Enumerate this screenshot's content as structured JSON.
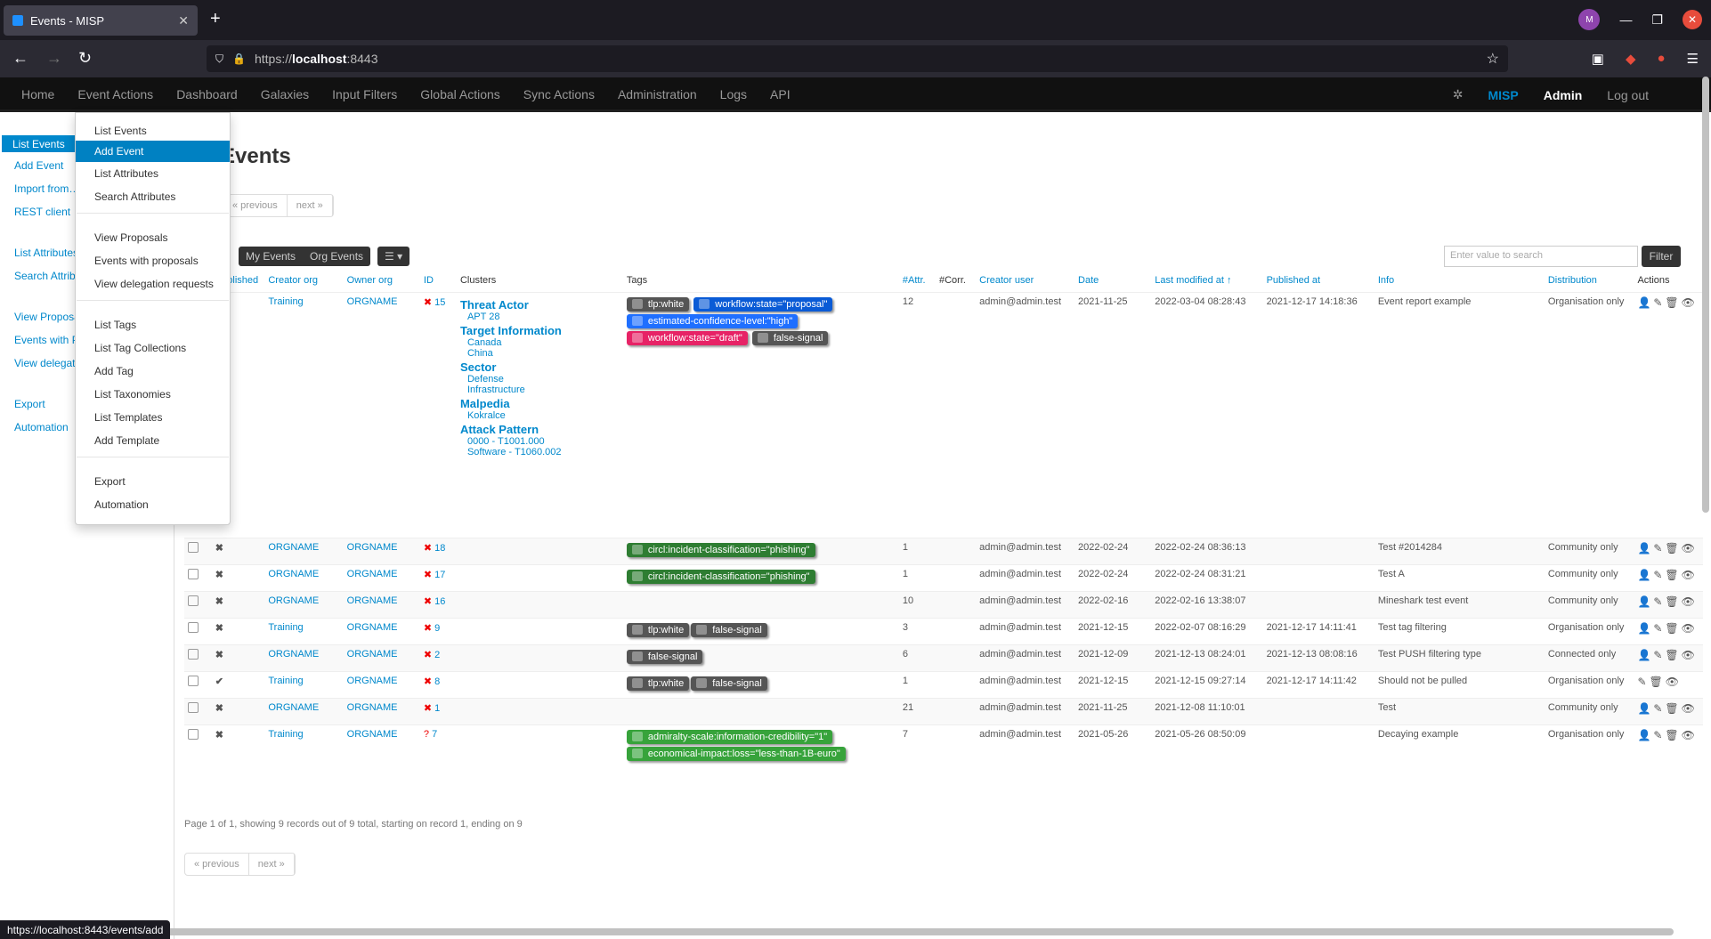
{
  "browser": {
    "tab_title": "Events - MISP",
    "url_prefix": "https://",
    "url_host": "localhost",
    "url_port": ":8443",
    "status_url": "https://localhost:8443/events/add"
  },
  "misp_menu": [
    "Home",
    "Event Actions",
    "Dashboard",
    "Galaxies",
    "Input Filters",
    "Global Actions",
    "Sync Actions",
    "Administration",
    "Logs",
    "API"
  ],
  "misp_right": {
    "org": "MISP",
    "user": "Admin",
    "logout": "Log out"
  },
  "sidebar": {
    "active": "List Events",
    "items": [
      "Add Event",
      "Import from…",
      "REST client",
      "List Attributes",
      "Search Attributes",
      "View Proposals",
      "Events with Proposals",
      "View delegation requests",
      "Export",
      "Automation"
    ]
  },
  "dropdown": {
    "items": [
      "List Events",
      "Add Event",
      "List Attributes",
      "Search Attributes",
      "View Proposals",
      "Events with proposals",
      "View delegation requests",
      "List Tags",
      "List Tag Collections",
      "Add Tag",
      "List Taxonomies",
      "List Templates",
      "Add Template",
      "Export",
      "Automation"
    ],
    "active": "Add Event"
  },
  "page_title": "Events",
  "pager": {
    "prev": "« previous",
    "next": "next »",
    "info": "Page 1 of 1, showing 9 records out of 9 total, starting on record 1, ending on 9"
  },
  "filters": {
    "my_events": "My Events",
    "org_events": "Org Events",
    "search_placeholder": "Enter value to search",
    "filter_btn": "Filter"
  },
  "table": {
    "headers": [
      "Published",
      "Creator org",
      "Owner org",
      "ID",
      "Clusters",
      "Tags",
      "#Attr.",
      "#Corr.",
      "Creator user",
      "Date",
      "Last modified at ↑",
      "Published at",
      "Info",
      "Distribution",
      "Actions"
    ],
    "first_row": {
      "creator": "Training",
      "owner": "ORGNAME",
      "id": "15",
      "clusters": [
        {
          "name": "Threat Actor",
          "values": [
            "APT 28"
          ]
        },
        {
          "name": "Target Information",
          "values": [
            "Canada",
            "China"
          ]
        },
        {
          "name": "Sector",
          "values": [
            "Defense",
            "Infrastructure"
          ]
        },
        {
          "name": "Malpedia",
          "values": [
            "Kokralce"
          ]
        },
        {
          "name": "Attack Pattern",
          "values": [
            "0000 - T1001.000",
            "Software - T1060.002"
          ]
        }
      ],
      "tags": [
        "tlp:white",
        "workflow:state=\"proposal\"",
        "estimated-confidence-level:\"high\"",
        "workflow:state=\"draft\"",
        "false-signal"
      ],
      "attr": "12",
      "user": "admin@admin.test",
      "date": "2021-11-25",
      "modified": "2022-03-04 08:28:43",
      "published_at": "2021-12-17 14:18:36",
      "info": "Event report example",
      "distribution": "Organisation only"
    },
    "rows": [
      {
        "id": "18",
        "creator": "ORGNAME",
        "owner": "ORGNAME",
        "tags": [
          "circl:incident-classification=\"phishing\""
        ],
        "attr": "1",
        "user": "admin@admin.test",
        "date": "2022-02-24",
        "modified": "2022-02-24 08:36:13",
        "published_at": "",
        "info": "Test #2014284",
        "distribution": "Community only",
        "pub": "✖"
      },
      {
        "id": "17",
        "creator": "ORGNAME",
        "owner": "ORGNAME",
        "tags": [
          "circl:incident-classification=\"phishing\""
        ],
        "attr": "1",
        "user": "admin@admin.test",
        "date": "2022-02-24",
        "modified": "2022-02-24 08:31:21",
        "published_at": "",
        "info": "Test A",
        "distribution": "Community only",
        "pub": "✖"
      },
      {
        "id": "16",
        "creator": "ORGNAME",
        "owner": "ORGNAME",
        "tags": [],
        "attr": "10",
        "user": "admin@admin.test",
        "date": "2022-02-16",
        "modified": "2022-02-16 13:38:07",
        "published_at": "",
        "info": "Mineshark test event",
        "distribution": "Community only",
        "pub": "✖"
      },
      {
        "id": "9",
        "creator": "Training",
        "owner": "ORGNAME",
        "tags": [
          "tlp:white",
          "false-signal"
        ],
        "attr": "3",
        "user": "admin@admin.test",
        "date": "2021-12-15",
        "modified": "2022-02-07 08:16:29",
        "published_at": "2021-12-17 14:11:41",
        "info": "Test tag filtering",
        "distribution": "Organisation only",
        "pub": "✖"
      },
      {
        "id": "2",
        "creator": "ORGNAME",
        "owner": "ORGNAME",
        "tags": [
          "false-signal"
        ],
        "attr": "6",
        "user": "admin@admin.test",
        "date": "2021-12-09",
        "modified": "2021-12-13 08:24:01",
        "published_at": "2021-12-13 08:08:16",
        "info": "Test PUSH filtering type",
        "distribution": "Connected only",
        "pub": "✖"
      },
      {
        "id": "8",
        "creator": "Training",
        "owner": "ORGNAME",
        "tags": [
          "tlp:white",
          "false-signal"
        ],
        "attr": "1",
        "user": "admin@admin.test",
        "date": "2021-12-15",
        "modified": "2021-12-15 09:27:14",
        "published_at": "2021-12-17 14:11:42",
        "info": "Should not be pulled",
        "distribution": "Organisation only",
        "pub": "✔"
      },
      {
        "id": "1",
        "creator": "ORGNAME",
        "owner": "ORGNAME",
        "tags": [],
        "attr": "21",
        "user": "admin@admin.test",
        "date": "2021-11-25",
        "modified": "2021-12-08 11:10:01",
        "published_at": "",
        "info": "Test",
        "distribution": "Community only",
        "pub": "✖"
      },
      {
        "id": "7",
        "creator": "Training",
        "owner": "ORGNAME",
        "tags": [
          "admiralty-scale:information-credibility=\"1\"",
          "economical-impact:loss=\"less-than-1B-euro\""
        ],
        "attr": "7",
        "user": "admin@admin.test",
        "date": "2021-05-26",
        "modified": "2021-05-26 08:50:09",
        "published_at": "",
        "info": "Decaying example",
        "distribution": "Organisation only",
        "pub": "✖"
      }
    ]
  },
  "colors": {
    "brand": "#0088cc",
    "navbar": "#111111"
  }
}
